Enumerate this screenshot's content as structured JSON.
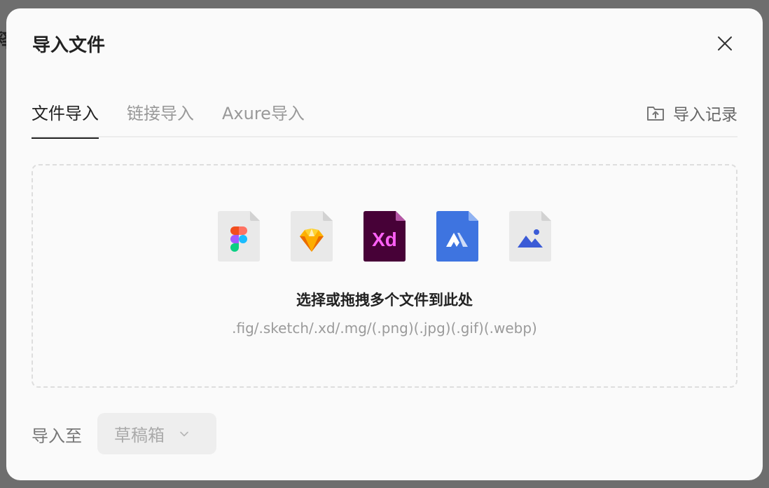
{
  "backdrop": {
    "glyph": "释"
  },
  "dialog": {
    "title": "导入文件"
  },
  "tabs": [
    {
      "label": "文件导入",
      "active": true
    },
    {
      "label": "链接导入",
      "active": false
    },
    {
      "label": "Axure导入",
      "active": false
    }
  ],
  "history": {
    "label": "导入记录",
    "icon": "folder-upload-icon"
  },
  "dropzone": {
    "icons": [
      "figma-file-icon",
      "sketch-file-icon",
      "xd-file-icon",
      "mastergo-file-icon",
      "image-file-icon"
    ],
    "xd_text": "Xd",
    "title": "选择或拖拽多个文件到此处",
    "formats": ".fig/.sketch/.xd/.mg/(.png)(.jpg)(.gif)(.webp)"
  },
  "import_to": {
    "label": "导入至",
    "selected": "草稿箱"
  },
  "colors": {
    "xd_bg": "#470137",
    "xd_text": "#ff61f6",
    "mastergo_bg": "#3e74e0",
    "image_accent": "#3b5bd6",
    "sketch_gold": "#f7b500"
  }
}
